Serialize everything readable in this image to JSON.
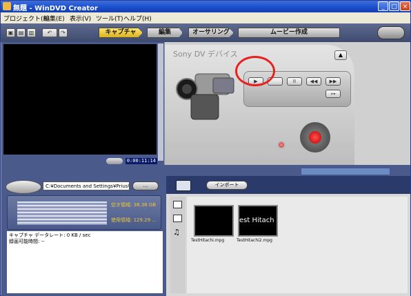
{
  "window": {
    "title": "無題 - WinDVD Creator",
    "min_btn": "_",
    "max_btn": "□",
    "close_btn": "×"
  },
  "menu": [
    "プロジェクト(P)",
    "編集(E)",
    "表示(V)",
    "ツール(T)",
    "ヘルプ(H)"
  ],
  "toolbar": {
    "steps": [
      "キャプチャ",
      "編集",
      "オーサリング",
      "ムービー作成"
    ],
    "active_step": "キャプチャ"
  },
  "preview": {
    "timecode": "0:00:11:14"
  },
  "device": {
    "title": "Sony DV デバイス",
    "controls": [
      "▶",
      "",
      "II",
      "◀◀",
      "▶▶",
      "⊶"
    ]
  },
  "capture": {
    "path": "C:¥Documents and Settings¥Prius¥...",
    "folder_button": "...",
    "free_space": "空き領域: 38.38 GB",
    "used_space": "使用領域: 129.29 ...",
    "data_rate": "キャプチャ データレート: 0 KB / sec",
    "record_time": "録画可能時間: --"
  },
  "media": {
    "import_label": "インポート",
    "items": [
      {
        "filename": "TestHitachi.mpg",
        "thumb_text": ""
      },
      {
        "filename": "TestHitachi2.mpg",
        "thumb_text": "est Hitach"
      }
    ]
  },
  "colors": {
    "title_bar": "#1a4cc8",
    "active_step": "#ffe86a",
    "record_red": "#e82020",
    "panel_blue": "#4a5a8a"
  }
}
